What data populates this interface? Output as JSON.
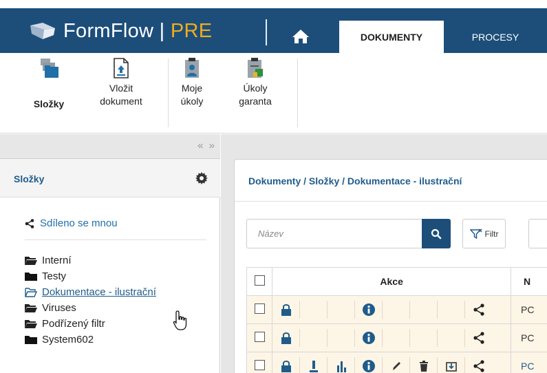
{
  "app": {
    "brand_name": "FormFlow",
    "brand_separator": " | ",
    "brand_edition": "PRE",
    "nav_tabs": [
      {
        "label": "DOKUMENTY",
        "active": true
      },
      {
        "label": "PROCESY",
        "active": false
      }
    ]
  },
  "ribbon": {
    "buttons": [
      {
        "line1": "",
        "line2": "Složky",
        "icon": "folders-icon"
      },
      {
        "line1": "Vložit",
        "line2": "dokument",
        "icon": "upload-document-icon"
      },
      {
        "line1": "Moje",
        "line2": "úkoly",
        "icon": "my-tasks-icon"
      },
      {
        "line1": "Úkoly",
        "line2": "garanta",
        "icon": "guarantor-tasks-icon"
      }
    ]
  },
  "sidebar": {
    "collapse_arrows": "« »",
    "title": "Složky",
    "shared_label": "Sdíleno se mnou",
    "folders": [
      {
        "label": "Interní",
        "icon": "folder-open-icon",
        "selected": false
      },
      {
        "label": "Testy",
        "icon": "folder-closed-icon",
        "selected": false
      },
      {
        "label": "Dokumentace - ilustrační",
        "icon": "folder-open-outline-icon",
        "selected": true
      },
      {
        "label": "Viruses",
        "icon": "folder-open-icon",
        "selected": false
      },
      {
        "label": "Podřízený filtr",
        "icon": "folder-open-icon",
        "selected": false
      },
      {
        "label": "System602",
        "icon": "folder-closed-icon",
        "selected": false
      }
    ]
  },
  "main": {
    "breadcrumb": "Dokumenty / Složky / Dokumentace - ilustrační",
    "search": {
      "placeholder": "Název",
      "value": ""
    },
    "filter_label": "Filtr",
    "table": {
      "headers": [
        "",
        "Akce",
        "N"
      ],
      "rows": [
        {
          "name": "PC",
          "actions": [
            "lock-icon",
            "",
            "",
            "info-icon",
            "",
            "",
            "share-icon"
          ]
        },
        {
          "name": "PC",
          "actions": [
            "lock-icon",
            "",
            "",
            "info-icon",
            "",
            "",
            "share-icon"
          ]
        },
        {
          "name": "PC",
          "actions": [
            "lock-icon",
            "download-icon",
            "chart-icon",
            "info-icon",
            "edit-icon",
            "trash-icon",
            "share-icon"
          ]
        }
      ]
    }
  },
  "colors": {
    "brand": "#1d4e7a",
    "accent": "#f0ad1f",
    "link": "#1f5c8c",
    "row_highlight": "#fdf5e6"
  }
}
